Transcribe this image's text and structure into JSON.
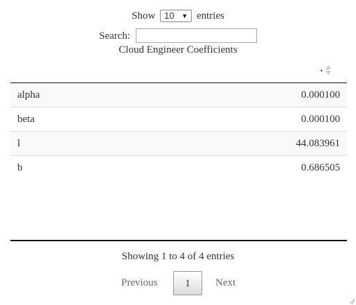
{
  "length_control": {
    "prefix": "Show",
    "selected": "10",
    "suffix": "entries"
  },
  "search": {
    "label": "Search:",
    "value": ""
  },
  "table": {
    "caption": "Cloud Engineer Coefficients",
    "column_header": ".",
    "rows": [
      {
        "name": "alpha",
        "value": "0.000100"
      },
      {
        "name": "beta",
        "value": "0.000100"
      },
      {
        "name": "l",
        "value": "44.083961"
      },
      {
        "name": "b",
        "value": "0.686505"
      }
    ]
  },
  "info": "Showing 1 to 4 of 4 entries",
  "pagination": {
    "previous": "Previous",
    "current_page": "1",
    "next": "Next"
  }
}
